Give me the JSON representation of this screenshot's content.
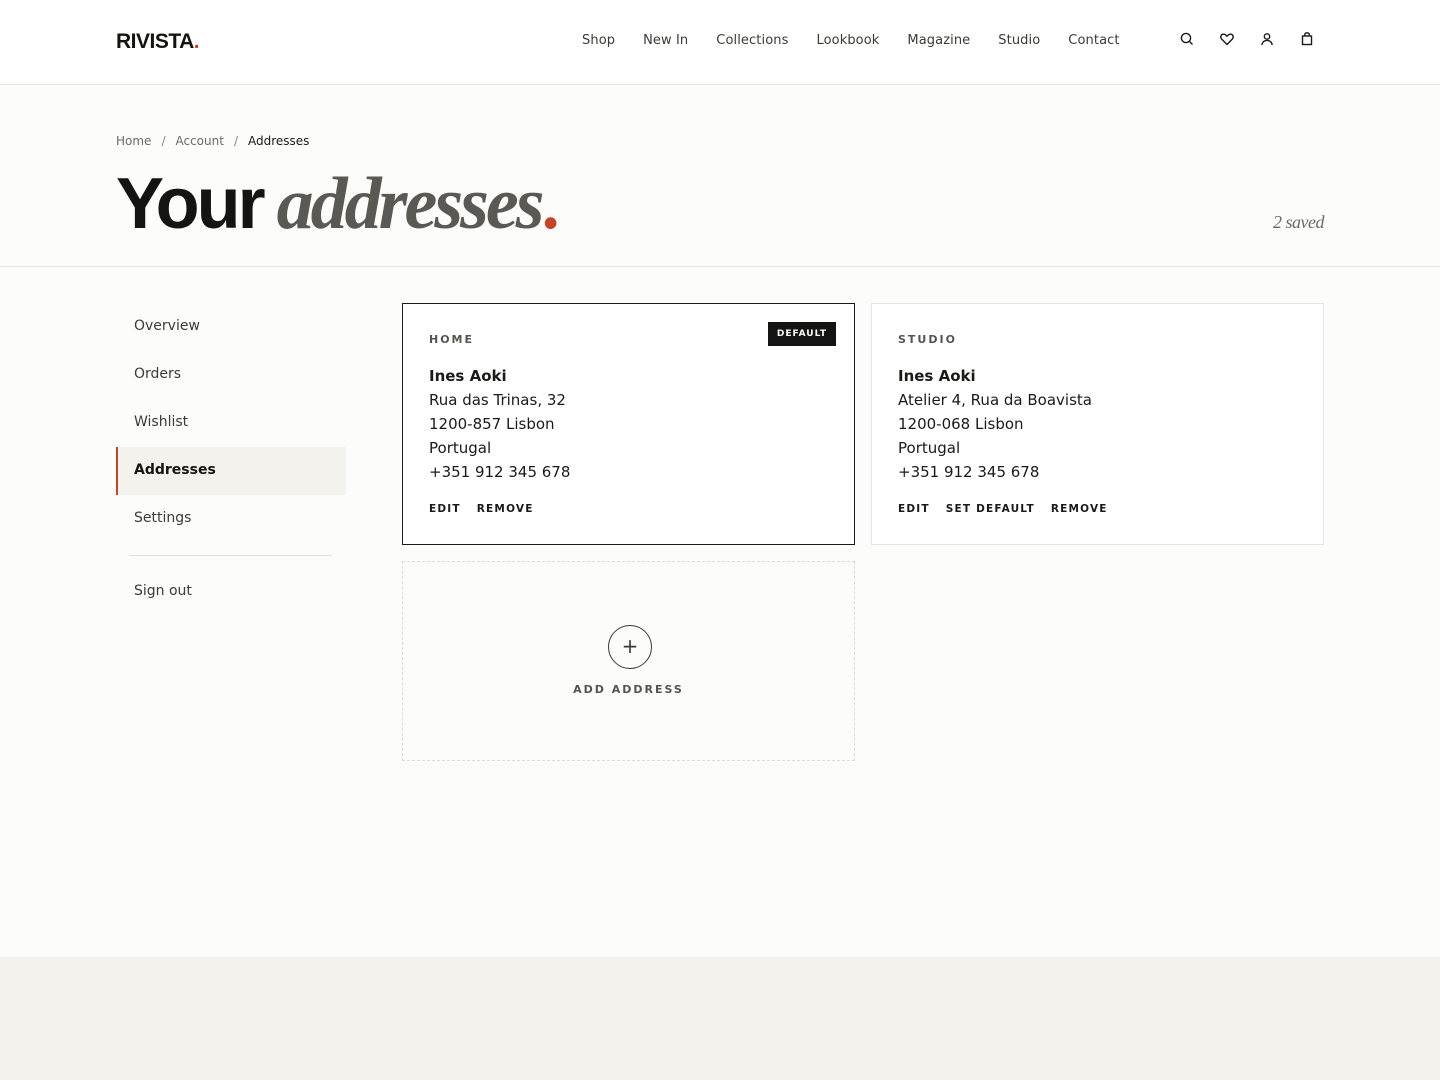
{
  "brand": {
    "name": "RIVISTA",
    "dot": ".",
    "accent": "#c2452a"
  },
  "nav": [
    "Shop",
    "New In",
    "Collections",
    "Lookbook",
    "Magazine",
    "Studio",
    "Contact"
  ],
  "header_icons": [
    "search-icon",
    "heart-icon",
    "user-icon",
    "bag-icon"
  ],
  "breadcrumb": {
    "home": "Home",
    "account": "Account",
    "current": "Addresses",
    "sep": "/"
  },
  "title": {
    "strong": "Your",
    "italic": "addresses",
    "dot": "."
  },
  "saved_count": "2 saved",
  "sidebar": {
    "items": [
      "Overview",
      "Orders",
      "Wishlist",
      "Addresses",
      "Settings"
    ],
    "active": "Addresses",
    "sign_out": "Sign out"
  },
  "addresses": [
    {
      "label": "HOME",
      "badge": "DEFAULT",
      "name": "Ines Aoki",
      "line1": "Rua das Trinas, 32",
      "line2": "1200-857 Lisbon",
      "country": "Portugal",
      "phone": "+351 912 345 678",
      "actions": [
        "EDIT",
        "REMOVE"
      ]
    },
    {
      "label": "STUDIO",
      "name": "Ines Aoki",
      "line1": "Atelier 4, Rua da Boavista",
      "line2": "1200-068 Lisbon",
      "country": "Portugal",
      "phone": "+351 912 345 678",
      "actions": [
        "EDIT",
        "SET DEFAULT",
        "REMOVE"
      ]
    }
  ],
  "add_address": {
    "symbol": "+",
    "label": "ADD ADDRESS"
  }
}
